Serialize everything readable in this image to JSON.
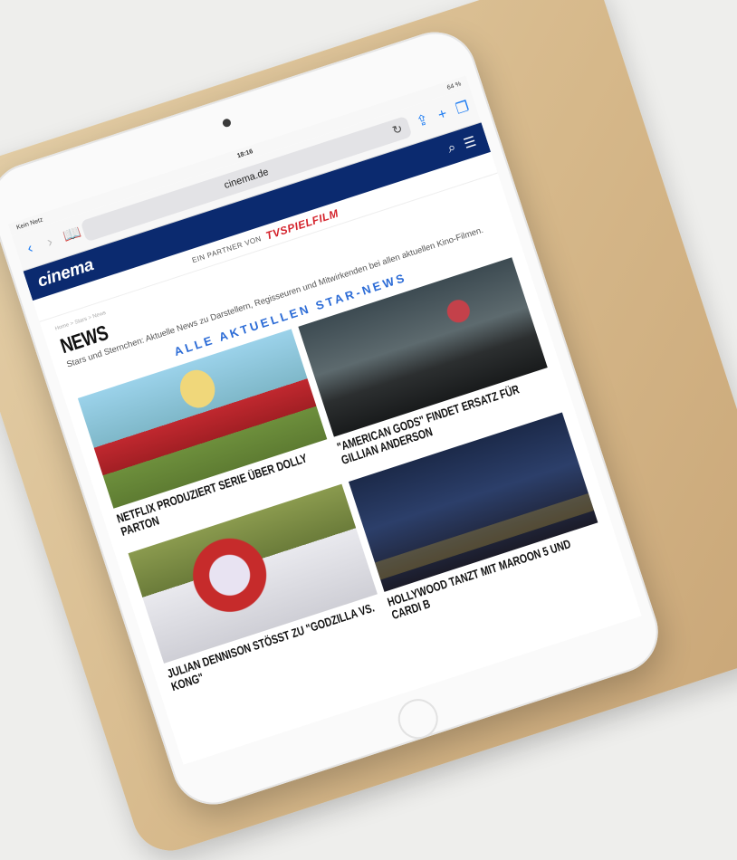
{
  "status_bar": {
    "carrier": "Kein Netz",
    "time": "18:16",
    "battery": "64 %"
  },
  "safari": {
    "url": "cinema.de"
  },
  "site": {
    "logo": "cinema",
    "partner_text": "EIN PARTNER VON",
    "partner_logo": "TVSPIELFILM"
  },
  "page": {
    "breadcrumb": "Home > Stars > News",
    "title": "NEWS",
    "description": "Stars und Sternchen: Aktuelle News zu Darstellern, Regisseuren und Mitwirkenden bei allen aktuellen Kino-Filmen.",
    "all_news_link": "ALLE AKTUELLEN STAR-NEWS"
  },
  "articles": [
    {
      "headline": "NETFLIX PRODUZIERT SERIE ÜBER DOLLY PARTON"
    },
    {
      "headline": "\"AMERICAN GODS\" FINDET ERSATZ FÜR GILLIAN ANDERSON"
    },
    {
      "headline": "JULIAN DENNISON STÖSST ZU \"GODZILLA VS. KONG\""
    },
    {
      "headline": "HOLLYWOOD TANZT MIT MAROON 5 UND CARDI B"
    }
  ],
  "colors": {
    "brand_navy": "#0b2a6f",
    "link_blue": "#2b6bd6",
    "ios_blue": "#1d7cf2"
  }
}
